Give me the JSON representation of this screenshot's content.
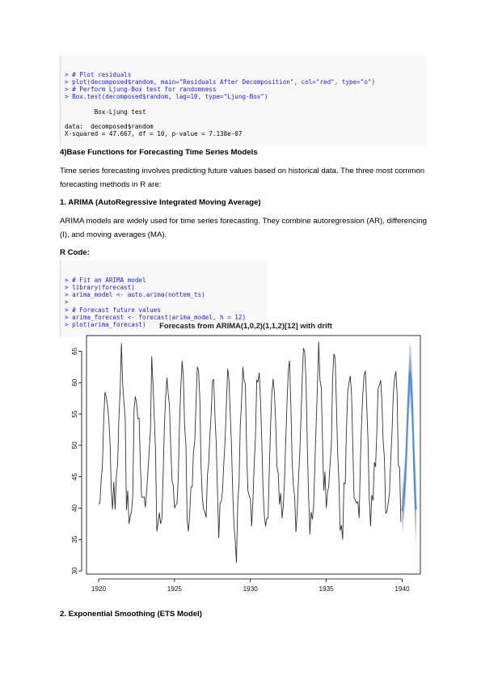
{
  "code_block_1": {
    "lines": [
      {
        "text": "> # Plot residuals",
        "kind": "cmd"
      },
      {
        "text": "> plot(decomposed$random, main=\"Residuals After Decomposition\", col=\"red\", type=\"o\")",
        "kind": "cmd"
      },
      {
        "text": "> # Perform Ljung-Box test for randomness",
        "kind": "cmd"
      },
      {
        "text": "> Box.test(decomposed$random, lag=10, type=\"Ljung-Box\")",
        "kind": "cmd"
      },
      {
        "text": "",
        "kind": "out"
      },
      {
        "text": "        Box-Ljung test",
        "kind": "out"
      },
      {
        "text": "",
        "kind": "out"
      },
      {
        "text": "data:  decomposed$random",
        "kind": "out"
      },
      {
        "text": "X-squared = 47.667, df = 10, p-value = 7.138e-07",
        "kind": "out"
      }
    ]
  },
  "section_heading": "4)Base Functions for Forecasting Time Series Models",
  "intro_paragraph": "Time series forecasting involves predicting future values based on historical data. The three most common forecasting methods in R are:",
  "arima_heading": "1. ARIMA (AutoRegressive Integrated Moving Average)",
  "arima_paragraph": "ARIMA models are widely used for time series forecasting. They combine autoregression (AR), differencing (I), and moving averages (MA).",
  "r_code_label": "R Code:",
  "code_block_2": {
    "lines": [
      {
        "text": "> # Fit an ARIMA model",
        "kind": "cmd"
      },
      {
        "text": "> library(forecast)",
        "kind": "cmd"
      },
      {
        "text": "> arima_model <- auto.arima(nottem_ts)",
        "kind": "cmd"
      },
      {
        "text": ">",
        "kind": "cmd"
      },
      {
        "text": "> # Forecast future values",
        "kind": "cmd"
      },
      {
        "text": "> arima_forecast <- forecast(arima_model, h = 12)",
        "kind": "cmd"
      },
      {
        "text": "> plot(arima_forecast)",
        "kind": "cmd"
      }
    ]
  },
  "ets_heading": "2. Exponential Smoothing (ETS Model)",
  "chart_data": {
    "type": "line",
    "title": "Forecasts from ARIMA(1,0,2)(1,1,2)[12] with drift",
    "xlabel": "",
    "ylabel": "",
    "xlim": [
      1919.2,
      1941.2
    ],
    "ylim": [
      29.5,
      67.5
    ],
    "x_ticks": [
      1920,
      1925,
      1930,
      1935,
      1940
    ],
    "y_ticks": [
      30,
      35,
      40,
      45,
      50,
      55,
      60,
      65
    ],
    "start_year": 1920,
    "frequency": 12,
    "series": [
      {
        "name": "",
        "color": "#333333",
        "values": [
          40.6,
          40.8,
          44.4,
          46.7,
          54.1,
          58.5,
          57.7,
          56.4,
          54.3,
          50.5,
          42.9,
          39.8,
          44.2,
          39.8,
          45.1,
          47.0,
          54.1,
          58.7,
          66.3,
          59.9,
          57.0,
          54.2,
          39.7,
          42.8,
          37.5,
          38.7,
          39.5,
          42.1,
          55.7,
          57.8,
          56.8,
          54.3,
          54.3,
          47.1,
          41.8,
          41.7,
          41.8,
          40.1,
          42.9,
          45.8,
          49.2,
          52.7,
          64.2,
          59.6,
          54.4,
          49.2,
          36.3,
          37.6,
          39.3,
          37.5,
          38.3,
          45.5,
          53.2,
          57.7,
          60.8,
          58.2,
          56.4,
          49.8,
          44.4,
          43.6,
          40.0,
          40.5,
          40.8,
          45.1,
          53.8,
          59.4,
          63.5,
          61.0,
          53.0,
          50.0,
          38.1,
          36.3,
          39.2,
          43.4,
          43.4,
          48.9,
          50.6,
          56.8,
          62.5,
          62.0,
          57.5,
          46.7,
          41.6,
          39.8,
          39.4,
          38.5,
          45.3,
          47.1,
          51.7,
          55.0,
          60.4,
          60.5,
          54.7,
          50.3,
          42.3,
          35.2,
          40.8,
          41.1,
          42.8,
          47.3,
          50.9,
          56.4,
          62.2,
          60.5,
          55.4,
          50.2,
          43.0,
          37.3,
          34.8,
          31.3,
          41.0,
          43.9,
          53.1,
          56.9,
          62.5,
          60.3,
          59.8,
          49.2,
          42.9,
          41.9,
          41.6,
          37.1,
          41.2,
          46.9,
          51.2,
          60.4,
          60.1,
          61.6,
          57.0,
          50.9,
          43.0,
          38.8,
          37.1,
          38.4,
          38.4,
          46.5,
          53.5,
          58.4,
          60.6,
          58.2,
          53.8,
          46.6,
          45.5,
          40.6,
          42.4,
          38.4,
          40.3,
          44.6,
          50.9,
          57.0,
          62.1,
          63.5,
          56.3,
          47.3,
          43.6,
          41.8,
          36.2,
          39.3,
          44.5,
          48.7,
          54.2,
          60.8,
          65.5,
          64.9,
          60.1,
          50.2,
          42.1,
          35.8,
          39.4,
          38.2,
          40.4,
          46.9,
          53.4,
          59.6,
          66.5,
          60.4,
          59.2,
          51.2,
          42.8,
          45.8,
          40.0,
          42.6,
          43.5,
          47.1,
          50.0,
          60.5,
          64.6,
          64.0,
          56.8,
          48.6,
          44.2,
          36.4,
          37.3,
          35.0,
          44.0,
          43.9,
          52.7,
          58.6,
          60.0,
          61.1,
          58.1,
          49.6,
          41.6,
          41.3,
          40.8,
          41.0,
          38.4,
          47.4,
          54.1,
          58.6,
          61.4,
          61.8,
          56.3,
          50.9,
          41.4,
          37.1,
          42.1,
          41.2,
          47.3,
          46.6,
          52.4,
          59.0,
          59.6,
          60.4,
          57.0,
          50.7,
          47.8,
          39.2,
          39.4,
          40.9,
          42.4,
          47.8,
          52.4,
          58.0,
          60.7,
          61.8,
          58.2,
          46.7,
          46.6,
          37.8
        ]
      },
      {
        "name": "",
        "color": "#4a90d9",
        "values": [
          39.5,
          41.2,
          43.5,
          47.0,
          52.8,
          57.9,
          61.7,
          60.5,
          56.6,
          49.2,
          42.9,
          39.8
        ]
      }
    ],
    "forecast_start": 1940,
    "interval_80_color": "#8e9fc2",
    "interval_95_color": "#c8cedd",
    "grid": false
  }
}
